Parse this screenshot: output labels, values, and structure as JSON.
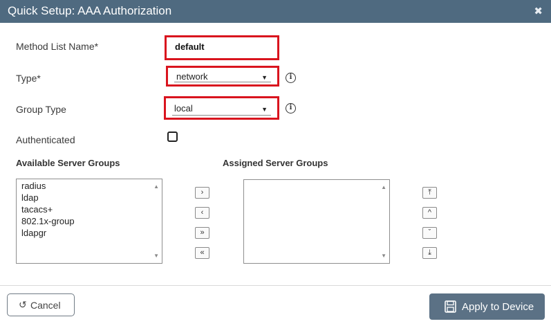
{
  "dialog": {
    "title": "Quick Setup: AAA Authorization",
    "close_glyph": "✖"
  },
  "form": {
    "method_list_label": "Method List Name*",
    "method_list_value": "default",
    "type_label": "Type*",
    "type_value": "network",
    "group_type_label": "Group Type",
    "group_type_value": "local",
    "authenticated_label": "Authenticated",
    "authenticated_checked": false,
    "info_glyph": "i",
    "caret_glyph": "▼"
  },
  "server_groups": {
    "available_title": "Available Server Groups",
    "assigned_title": "Assigned Server Groups",
    "available": [
      "radius",
      "ldap",
      "tacacs+",
      "802.1x-group",
      "ldapgr"
    ],
    "assigned": [],
    "move_right": "›",
    "move_left": "‹",
    "move_all_right": "»",
    "move_all_left": "«",
    "order_top": "⤒",
    "order_up": "^",
    "order_down": "ˇ",
    "order_bottom": "⤓"
  },
  "footer": {
    "cancel_label": "Cancel",
    "cancel_glyph": "↺",
    "apply_label": "Apply to Device"
  },
  "colors": {
    "titlebar": "#4f6a80",
    "highlight_frame": "#d9141e",
    "apply_button": "#5b7185"
  },
  "icons": {
    "close": "close-icon",
    "info": "info-icon",
    "cancel": "undo-icon",
    "apply": "save-icon"
  }
}
